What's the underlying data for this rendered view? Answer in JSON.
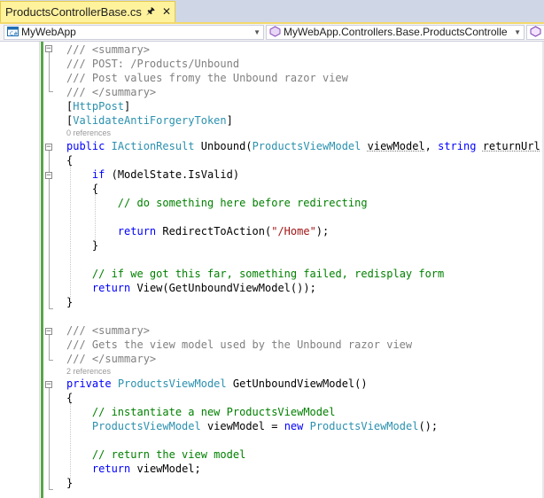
{
  "tab": {
    "title": "ProductsControllerBase.cs",
    "pin_icon": "pin-icon",
    "close_icon": "close-icon"
  },
  "navbar": {
    "project": "MyWebApp",
    "class_path": "MyWebApp.Controllers.Base.ProductsControlle"
  },
  "colors": {
    "keyword": "#0000ff",
    "type": "#2b91af",
    "comment": "#008000",
    "doc": "#808080",
    "string": "#a31515",
    "tab_active": "#fff29d"
  },
  "code": {
    "l1": "/// <summary>",
    "l2": "/// POST: /Products/Unbound",
    "l3": "/// Post values fromy the Unbound razor view",
    "l4": "/// </summary>",
    "l5_attr": "HttpPost",
    "l6_attr": "ValidateAntiForgeryToken",
    "lens1": "0 references",
    "l7": {
      "kw": "public",
      "type": "IActionResult",
      "name": "Unbound",
      "ptype": "ProductsViewModel",
      "p1": "viewModel",
      "kw2": "string",
      "p2": "returnUrl"
    },
    "l8": "{",
    "l9": {
      "kw": "if",
      "cond": "ModelState.IsValid"
    },
    "l10": "{",
    "l11": "// do something here before redirecting",
    "l12": {
      "kw": "return",
      "call": "RedirectToAction",
      "arg": "\"/Home\""
    },
    "l13": "}",
    "l14": "// if we got this far, something failed, redisplay form",
    "l15": {
      "kw": "return",
      "expr": "View(GetUnboundViewModel());"
    },
    "l16": "}",
    "l17": "/// <summary>",
    "l18": "/// Gets the view model used by the Unbound razor view",
    "l19": "/// </summary>",
    "lens2": "2 references",
    "l20": {
      "kw": "private",
      "type": "ProductsViewModel",
      "name": "GetUnboundViewModel()"
    },
    "l21": "{",
    "l22": "// instantiate a new ProductsViewModel",
    "l23": {
      "type": "ProductsViewModel",
      "var": "viewModel",
      "kw": "new",
      "type2": "ProductsViewModel"
    },
    "l24": "// return the view model",
    "l25": {
      "kw": "return",
      "expr": "viewModel;"
    },
    "l26": "}"
  }
}
